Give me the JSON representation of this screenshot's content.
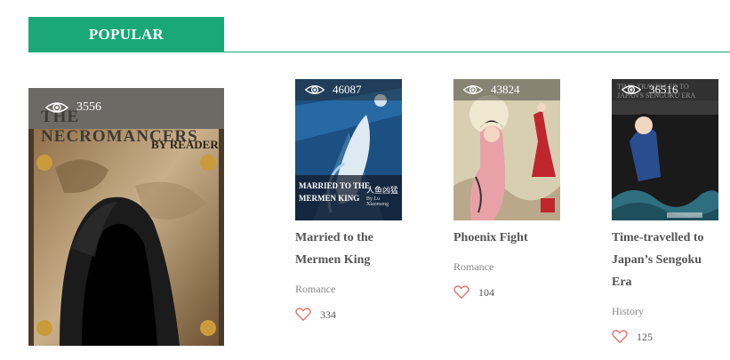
{
  "section": {
    "title": "POPULAR"
  },
  "featured": {
    "views": "3556",
    "cover_title": "THE NECROMANCERS",
    "cover_author": "BY READER"
  },
  "books": [
    {
      "views": "46087",
      "cover_title_line1": "MARRIED TO THE",
      "cover_title_line2": "MERMEN KING",
      "cover_cn": "人鱼凶猛",
      "cover_author": "By Lu Xiaomeng",
      "title": "Married to the Mermen King",
      "genre": "Romance",
      "likes": "334"
    },
    {
      "views": "43824",
      "title": "Phoenix Fight",
      "genre": "Romance",
      "likes": "104"
    },
    {
      "views": "36516",
      "cover_title": "TIME-TRAVELLED TO JAPAN'S SENGOKU ERA",
      "title": "Time-travelled to Japan’s Sengoku Era",
      "genre": "History",
      "likes": "125"
    }
  ],
  "colors": {
    "accent": "#1aa878",
    "heart": "#e57373"
  },
  "icons": {
    "views": "eye-icon",
    "likes": "heart-icon"
  }
}
